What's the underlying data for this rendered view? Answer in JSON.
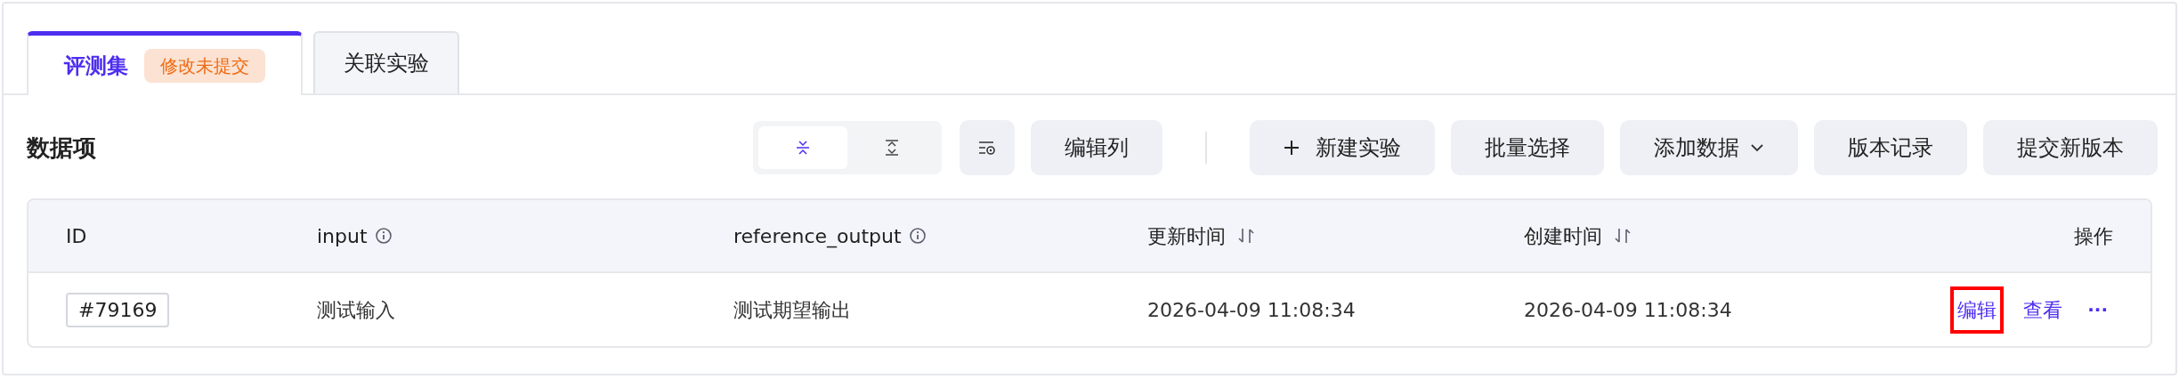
{
  "tabs": [
    {
      "label": "评测集",
      "selected": true,
      "badge": "修改未提交"
    },
    {
      "label": "关联实验",
      "selected": false
    }
  ],
  "section_title": "数据项",
  "toolbar": {
    "density": [
      {
        "kind": "compact",
        "selected": true
      },
      {
        "kind": "expand",
        "selected": false
      }
    ],
    "buttons": [
      {
        "kind": "filter-icon"
      },
      {
        "kind": "text",
        "label": "编辑列"
      },
      {
        "kind": "divider"
      },
      {
        "kind": "plus",
        "label": "新建实验"
      },
      {
        "kind": "text",
        "label": "批量选择"
      },
      {
        "kind": "dropdown",
        "label": "添加数据"
      },
      {
        "kind": "text",
        "label": "版本记录"
      },
      {
        "kind": "text",
        "label": "提交新版本"
      }
    ]
  },
  "table": {
    "columns": [
      {
        "label": "ID",
        "kind": "plain"
      },
      {
        "label": "input",
        "kind": "info"
      },
      {
        "label": "reference_output",
        "kind": "info"
      },
      {
        "label": "更新时间",
        "kind": "sort"
      },
      {
        "label": "创建时间",
        "kind": "sort"
      },
      {
        "label": "操作",
        "kind": "plain"
      }
    ],
    "rows": [
      {
        "cells": [
          "#79169",
          "测试输入",
          "测试期望输出",
          "2026-04-09 11:08:34",
          "2026-04-09 11:08:34"
        ],
        "actions": [
          {
            "kind": "link",
            "label": "编辑",
            "highlighted": true
          },
          {
            "kind": "link",
            "label": "查看",
            "highlighted": false
          },
          {
            "kind": "more",
            "label": "···",
            "highlighted": false
          }
        ]
      }
    ]
  }
}
